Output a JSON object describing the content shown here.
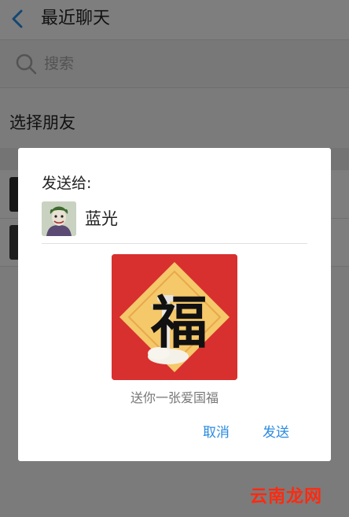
{
  "header": {
    "title": "最近聊天"
  },
  "search": {
    "placeholder": "搜索"
  },
  "section": {
    "title": "选择朋友"
  },
  "dialog": {
    "send_to_label": "发送给:",
    "recipient_name": "蓝光",
    "card_character": "福",
    "card_caption": "送你一张爱国福",
    "cancel_label": "取消",
    "send_label": "发送"
  },
  "watermark": "云南龙网",
  "colors": {
    "accent": "#2a8ae0",
    "card_red": "#d8302f",
    "card_gold": "#f5c86a",
    "watermark": "#ff2a10"
  },
  "icons": [
    "back-icon",
    "search-icon"
  ]
}
